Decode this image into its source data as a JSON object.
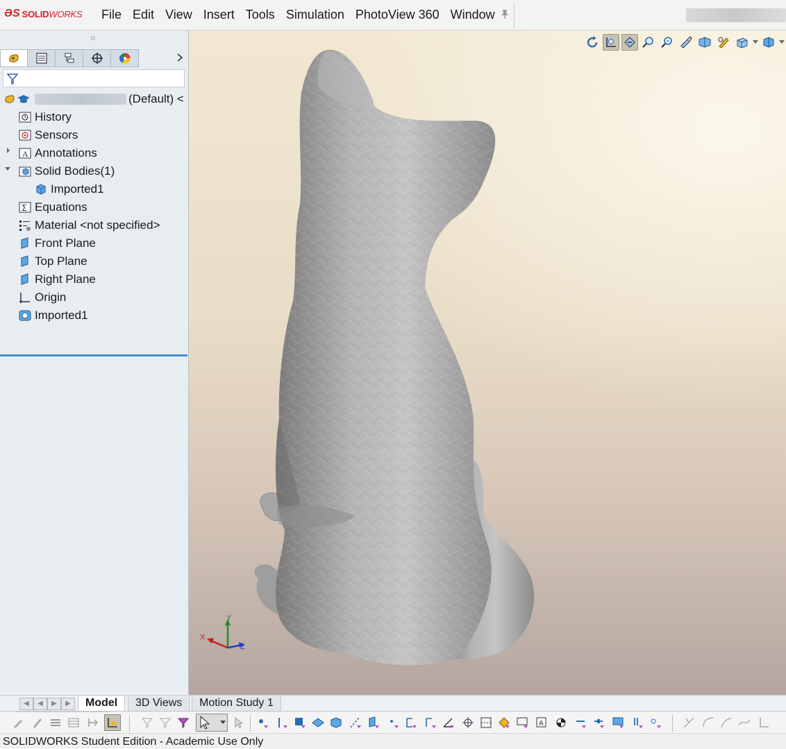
{
  "app": {
    "logo_ds": "ƏS",
    "logo_solid": "SOLID",
    "logo_works": "WORKS"
  },
  "menu": [
    "File",
    "Edit",
    "View",
    "Insert",
    "Tools",
    "Simulation",
    "PhotoView 360",
    "Window"
  ],
  "tree": {
    "root_config": "(Default) <",
    "items": [
      {
        "label": "History"
      },
      {
        "label": "Sensors"
      },
      {
        "label": "Annotations"
      },
      {
        "label": "Solid Bodies(1)"
      },
      {
        "label": "Imported1"
      },
      {
        "label": "Equations"
      },
      {
        "label": "Material <not specified>"
      },
      {
        "label": "Front Plane"
      },
      {
        "label": "Top Plane"
      },
      {
        "label": "Right Plane"
      },
      {
        "label": "Origin"
      },
      {
        "label": "Imported1"
      }
    ]
  },
  "triad": {
    "x": "X",
    "y": "Y",
    "z": "Z"
  },
  "bottom_tabs": {
    "model": "Model",
    "views3d": "3D Views",
    "motion": "Motion Study 1"
  },
  "status": {
    "text": "SOLIDWORKS Student Edition - Academic Use Only"
  },
  "colors": {
    "brand": "#d5222b",
    "rollback_bar": "#3b8ed8",
    "panel_bg": "#e8edf2",
    "model_gray": "#a9a9a9"
  }
}
